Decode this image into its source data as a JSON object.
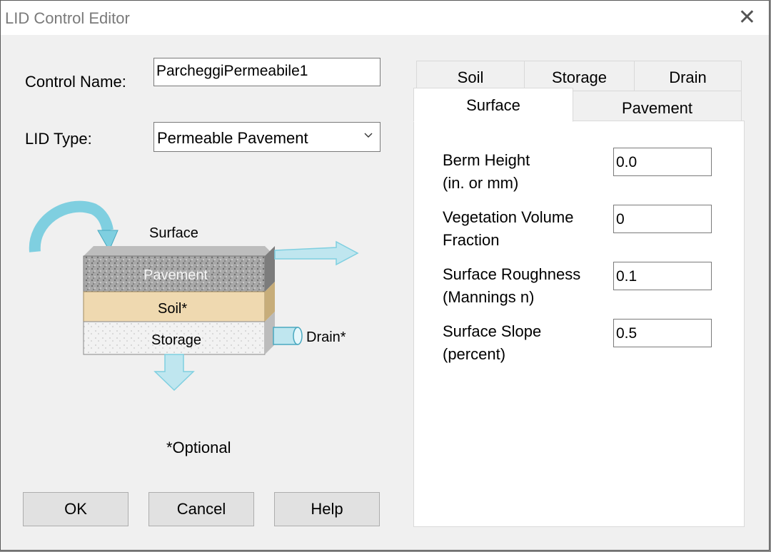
{
  "window": {
    "title": "LID Control Editor",
    "close_glyph": "✕"
  },
  "form": {
    "control_name_label": "Control Name:",
    "control_name_value": "ParcheggiPermeabile1",
    "lid_type_label": "LID Type:",
    "lid_type_value": "Permeable Pavement",
    "optional_note": "*Optional"
  },
  "diagram": {
    "surface": "Surface",
    "pavement": "Pavement",
    "soil": "Soil*",
    "storage": "Storage",
    "drain": "Drain*"
  },
  "buttons": {
    "ok": "OK",
    "cancel": "Cancel",
    "help": "Help"
  },
  "tabs": {
    "back_row": [
      "Soil",
      "Storage",
      "Drain"
    ],
    "front_row": [
      "Surface",
      "Pavement"
    ],
    "active": "Surface"
  },
  "surface_fields": [
    {
      "line1": "Berm Height",
      "line2": "(in. or mm)",
      "value": "0.0"
    },
    {
      "line1": "Vegetation Volume",
      "line2": "Fraction",
      "value": "0"
    },
    {
      "line1": "Surface Roughness",
      "line2": "(Mannings n)",
      "value": "0.1"
    },
    {
      "line1": "Surface Slope",
      "line2": "(percent)",
      "value": "0.5"
    }
  ],
  "colors": {
    "accent_arrow": "#7fcfe0",
    "pavement": "#9a9a9a",
    "soil": "#efd9b0",
    "storage": "#ececec"
  }
}
